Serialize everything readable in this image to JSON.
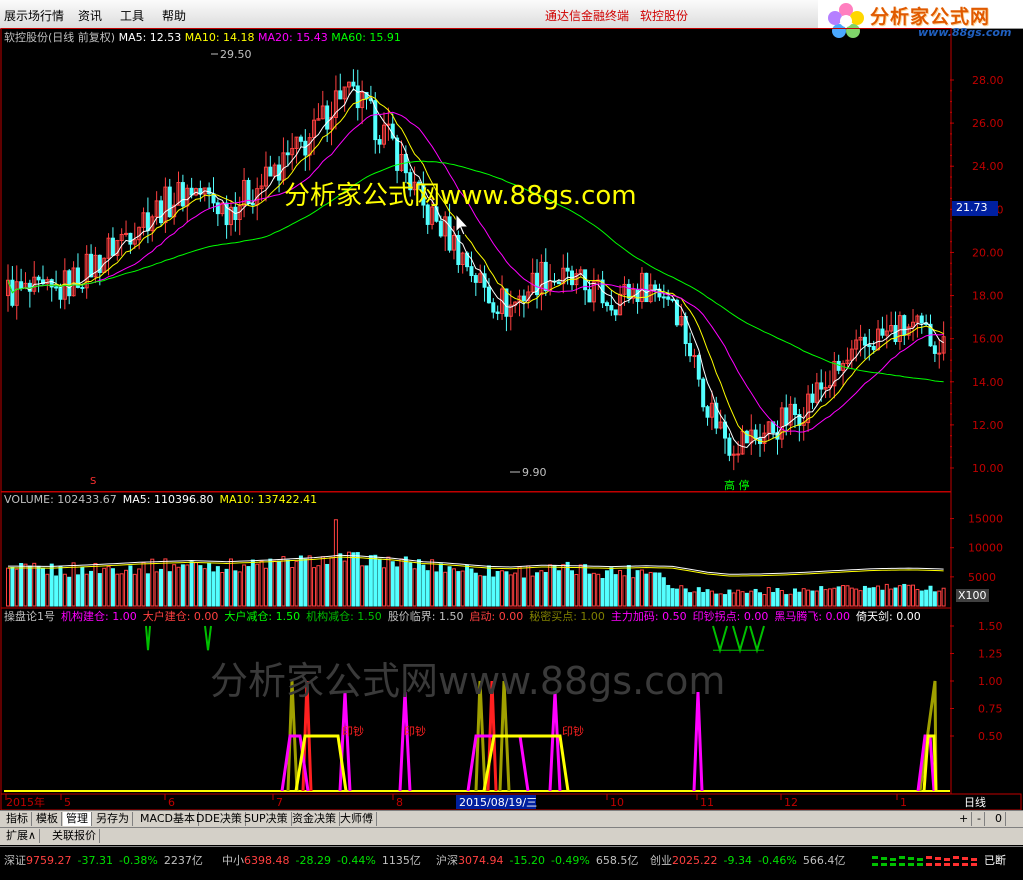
{
  "menubar": {
    "items": [
      "展示场行情",
      "资讯",
      "工具",
      "帮助"
    ],
    "ads": [
      "通达信金融终端",
      "软控股份"
    ],
    "logo_brand": "分析家公式网",
    "logo_url": "www.88gs.com"
  },
  "main_panel": {
    "stock_title": "软控股份(日线 前复权)",
    "ma": [
      {
        "label": "MA5: 12.53",
        "color": "#ffffff"
      },
      {
        "label": "MA10: 14.18",
        "color": "#ffff00"
      },
      {
        "label": "MA20: 15.43",
        "color": "#ff00ff"
      },
      {
        "label": "MA60: 15.91",
        "color": "#00ff00"
      }
    ],
    "high_label": "29.50",
    "low_label": "9.90",
    "price_ticks": [
      "28.00",
      "26.00",
      "24.00",
      "22.00",
      "20.00",
      "18.00",
      "16.00",
      "14.00",
      "12.00",
      "10.00"
    ],
    "current_price": "21.73",
    "watermark": "分析家公式网www.88gs.com",
    "tag_s": "S",
    "tag_gaoting": "高  停",
    "colors": {
      "up": "#ff4040",
      "down": "#54ffff",
      "axis": "#c00000",
      "watermark": "#ffff00"
    }
  },
  "volume_panel": {
    "header": [
      {
        "label": "VOLUME: 102433.67",
        "color": "#c0c0c0"
      },
      {
        "label": "MA5: 110396.80",
        "color": "#ffffff"
      },
      {
        "label": "MA10: 137422.41",
        "color": "#ffff00"
      }
    ],
    "ticks": [
      "15000",
      "10000",
      "5000"
    ],
    "unit": "X100"
  },
  "indicator_panel": {
    "header": [
      {
        "label": "操盘论1号",
        "color": "#c0c0c0"
      },
      {
        "label": "机构建仓: 1.00",
        "color": "#ff00ff"
      },
      {
        "label": "大户建仓: 0.00",
        "color": "#ff4040"
      },
      {
        "label": "大户减仓: 1.50",
        "color": "#00ff00"
      },
      {
        "label": "机构减仓: 1.50",
        "color": "#00c000"
      },
      {
        "label": "股价临界: 1.50",
        "color": "#c0c0c0"
      },
      {
        "label": "启动: 0.00",
        "color": "#ff4040"
      },
      {
        "label": "秘密买点: 1.00",
        "color": "#808000"
      },
      {
        "label": "主力加码: 0.50",
        "color": "#ff00ff"
      },
      {
        "label": "印钞拐点: 0.00",
        "color": "#ff00ff"
      },
      {
        "label": "黑马腾飞: 0.00",
        "color": "#ff00ff"
      },
      {
        "label": "倚天剑: 0.00",
        "color": "#ffffff"
      }
    ],
    "ticks": [
      "1.50",
      "1.25",
      "1.00",
      "0.75",
      "0.50"
    ],
    "signal_label": "印钞",
    "watermark": "分析家公式网www.88gs.com"
  },
  "date_axis": {
    "labels": [
      "2015年",
      "5",
      "6",
      "7",
      "8",
      "10",
      "11",
      "12",
      "1"
    ],
    "cursor_date": "2015/08/19/三",
    "period": "日线"
  },
  "tabs": [
    "指标",
    "模板",
    "管理",
    "另存为",
    "MACD基本",
    "DDE决策",
    "SUP决策",
    "资金决策",
    "大师傅"
  ],
  "tabs2": [
    "扩展∧",
    "关联报价"
  ],
  "tab_controls": [
    "+",
    "-",
    "0"
  ],
  "status": {
    "items": [
      {
        "name": "深证",
        "index": "9759.27",
        "chg": "-37.31",
        "pct": "-0.38%",
        "amt": "2237亿"
      },
      {
        "name": "中小",
        "index": "6398.48",
        "chg": "-28.29",
        "pct": "-0.44%",
        "amt": "1135亿"
      },
      {
        "name": "沪深",
        "index": "3074.94",
        "chg": "-15.20",
        "pct": "-0.49%",
        "amt": "658.5亿"
      },
      {
        "name": "创业",
        "index": "2025.22",
        "chg": "-9.34",
        "pct": "-0.46%",
        "amt": "566.4亿"
      }
    ],
    "end_text": "已断"
  }
}
